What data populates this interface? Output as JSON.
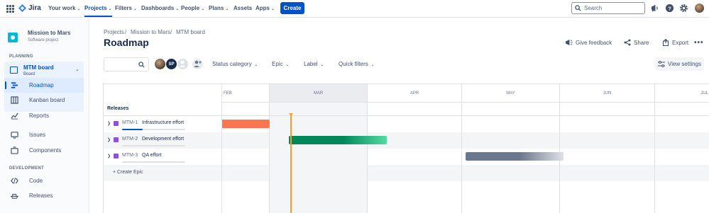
{
  "topnav": {
    "logo": "Jira",
    "items": [
      {
        "label": "Your work"
      },
      {
        "label": "Projects"
      },
      {
        "label": "Filters"
      },
      {
        "label": "Dashboards"
      },
      {
        "label": "People"
      },
      {
        "label": "Plans"
      },
      {
        "label": "Assets"
      },
      {
        "label": "Apps"
      }
    ],
    "create_label": "Create",
    "search_placeholder": "Search"
  },
  "sidebar": {
    "project_name": "Mission to Mars",
    "project_type": "Software project",
    "planning_label": "PLANNING",
    "board_name": "MTM board",
    "board_sub": "Board",
    "board_items": [
      {
        "label": "Roadmap"
      },
      {
        "label": "Kanban board"
      },
      {
        "label": "Reports"
      }
    ],
    "items": [
      {
        "label": "Issues"
      },
      {
        "label": "Components"
      }
    ],
    "development_label": "DEVELOPMENT",
    "dev_items": [
      {
        "label": "Code"
      },
      {
        "label": "Releases"
      }
    ]
  },
  "breadcrumb": [
    "Projects",
    "/",
    "Mission to Mars",
    "/",
    "MTM board"
  ],
  "page_title": "Roadmap",
  "actions": {
    "feedback": "Give feedback",
    "share": "Share",
    "export": "Export"
  },
  "filters": {
    "avatar_initials": "SP",
    "status": "Status category",
    "epic": "Epic",
    "label": "Label",
    "quick": "Quick filters",
    "view_settings": "View settings"
  },
  "timeline": {
    "months": [
      "FEB",
      "MAR",
      "APR",
      "MAY",
      "JUN",
      "JUL"
    ],
    "releases_label": "Releases",
    "create_epic": "+ Create Epic",
    "epics": [
      {
        "key": "MTM-1",
        "name": "Infrastructure effort",
        "progress": 0.33,
        "color": "#ff7452"
      },
      {
        "key": "MTM-2",
        "name": "Development effort",
        "progress": 0.0,
        "color": "#00875a"
      },
      {
        "key": "MTM-3",
        "name": "QA effort",
        "progress": 0.0,
        "color": "#6b778c"
      }
    ]
  },
  "colors": {
    "brand": "#0052cc",
    "today_marker": "#ff991f",
    "epic_icon": "#904ee2"
  }
}
